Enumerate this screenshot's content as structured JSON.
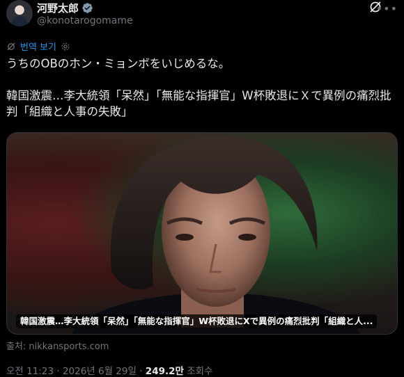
{
  "author": {
    "display_name": "河野太郎",
    "handle": "@konotarogomame",
    "verified": true
  },
  "translate": {
    "label": "번역 보기"
  },
  "tweet": {
    "text": "うちのOBのホン・ミョンボをいじめるな。\n\n韓国激震…李大統領「呆然」「無能な指揮官」W杯敗退にＸで異例の痛烈批判「組織と人事の失敗」"
  },
  "card": {
    "title": "韓国激震…李大統領「呆然」「無能な指揮官」W杯敗退にXで異例の痛烈批判「組織と人...",
    "source": "출처: nikkansports.com"
  },
  "meta": {
    "time": "오전 11:23",
    "date": "2026년 6월 29일",
    "views_count": "249.2만",
    "views_label": "조회수"
  },
  "colors": {
    "background": "#000000",
    "accent": "#1d9bf0",
    "secondary_text": "#71767b"
  }
}
